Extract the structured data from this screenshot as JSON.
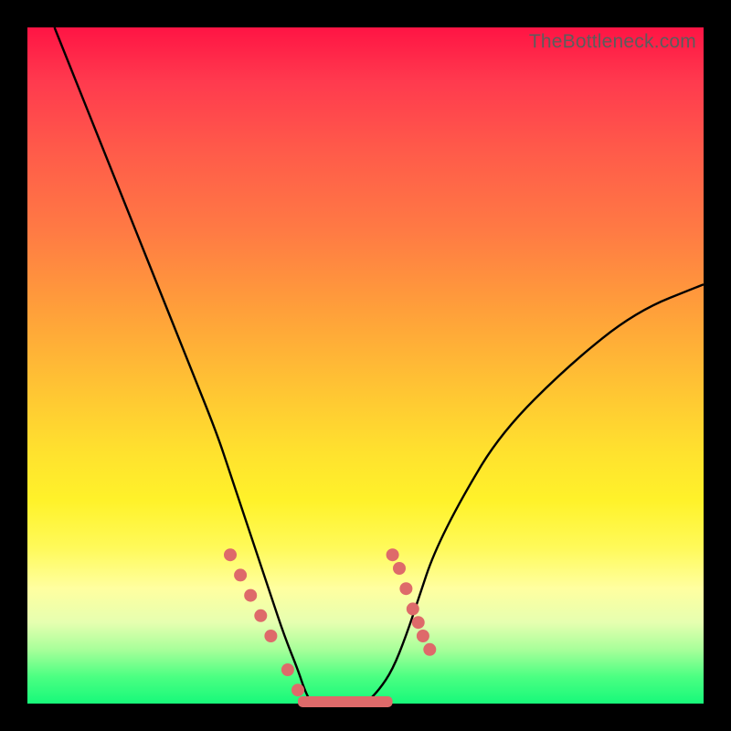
{
  "watermark": "TheBottleneck.com",
  "colors": {
    "marker": "#de6a6a",
    "curve": "#000000",
    "marker_band": "#de6a6a"
  },
  "chart_data": {
    "type": "line",
    "title": "",
    "xlabel": "",
    "ylabel": "",
    "xlim": [
      0,
      100
    ],
    "ylim": [
      0,
      100
    ],
    "grid": false,
    "series": [
      {
        "name": "bottleneck-curve",
        "x": [
          4,
          8,
          12,
          16,
          20,
          24,
          28,
          30,
          32,
          34,
          36,
          38,
          40,
          41,
          42,
          43,
          44,
          46,
          48,
          50,
          52,
          54,
          56,
          58,
          60,
          64,
          70,
          80,
          90,
          100
        ],
        "y": [
          100,
          90,
          80,
          70,
          60,
          50,
          40,
          34,
          28,
          22,
          16,
          10,
          5,
          2,
          0,
          0,
          0,
          0,
          0,
          0,
          2,
          5,
          10,
          16,
          22,
          30,
          40,
          50,
          58,
          62
        ]
      },
      {
        "name": "left-markers",
        "x": [
          30,
          31.5,
          33,
          34.5,
          36,
          38.5,
          40
        ],
        "y": [
          22,
          19,
          16,
          13,
          10,
          5,
          2
        ]
      },
      {
        "name": "right-markers",
        "x": [
          54,
          55,
          56,
          57,
          57.8,
          58.5,
          59.5
        ],
        "y": [
          22,
          20,
          17,
          14,
          12,
          10,
          8
        ]
      },
      {
        "name": "bottom-band",
        "x_start": 40,
        "x_end": 54,
        "y": 0
      }
    ]
  }
}
